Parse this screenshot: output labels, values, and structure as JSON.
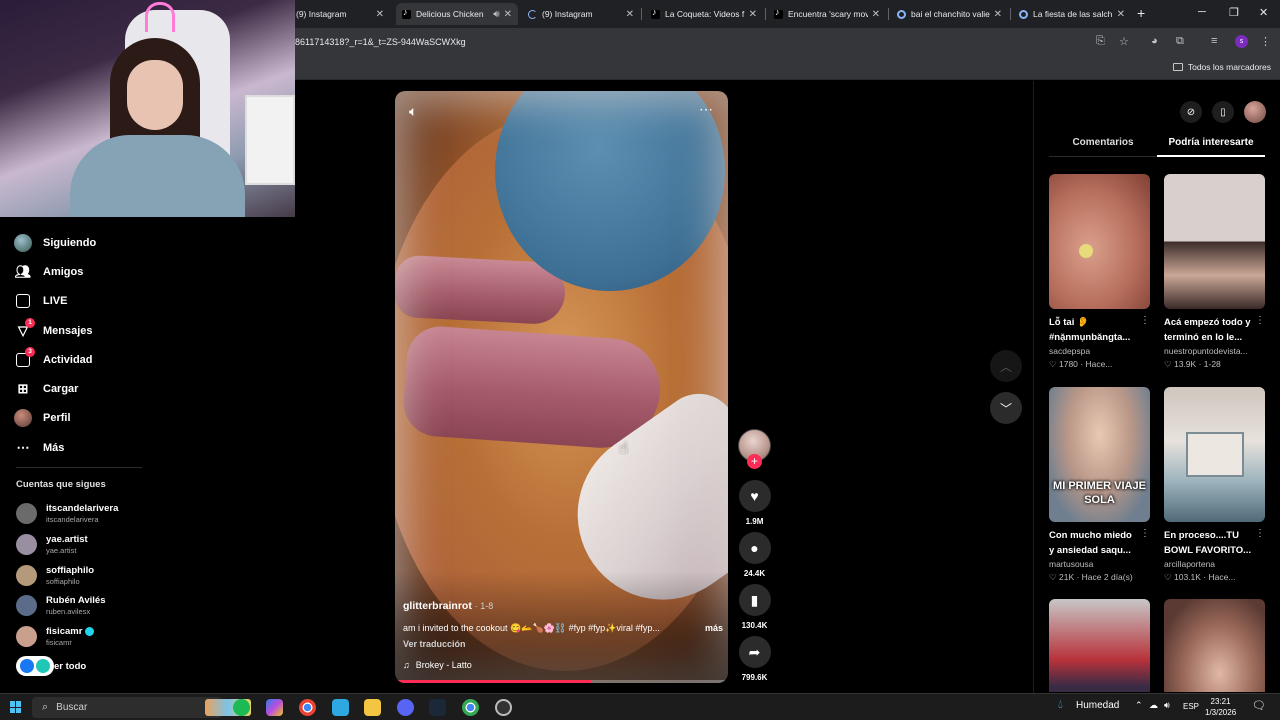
{
  "browser": {
    "tabs": [
      {
        "title": "(9) Instagram",
        "icon": "instagram-icon",
        "active": false
      },
      {
        "title": "Delicious Chicken",
        "icon": "tiktok-icon",
        "active": true
      },
      {
        "title": "(9) Instagram",
        "icon": "loading-icon",
        "active": false
      },
      {
        "title": "La Coqueta: Videos f",
        "icon": "tiktok-icon",
        "active": false
      },
      {
        "title": "Encuentra 'scary mov",
        "icon": "tiktok-icon",
        "active": false
      },
      {
        "title": "bai el chanchito valie",
        "icon": "google-icon",
        "active": false
      },
      {
        "title": "La fiesta de las salch",
        "icon": "google-icon",
        "active": false
      }
    ],
    "url": "8611714318?_r=1&_t=ZS-944WaSCWXkg",
    "profile_initial": "s",
    "bookmarks_all": "Todos los marcadores"
  },
  "sidebar": {
    "items": [
      {
        "label": "Siguiendo",
        "icon": "following-avatar-icon"
      },
      {
        "label": "Amigos",
        "icon": "friends-icon"
      },
      {
        "label": "LIVE",
        "icon": "live-icon"
      },
      {
        "label": "Mensajes",
        "icon": "messages-icon",
        "badge": "1"
      },
      {
        "label": "Actividad",
        "icon": "activity-icon",
        "badge": "3"
      },
      {
        "label": "Cargar",
        "icon": "upload-icon"
      },
      {
        "label": "Perfil",
        "icon": "profile-avatar-icon"
      },
      {
        "label": "Más",
        "icon": "more-icon"
      }
    ],
    "following_title": "Cuentas que sigues",
    "accounts": [
      {
        "name": "itscandelarivera",
        "handle": "itscandelarivera",
        "verified": false,
        "color": "#6b6b6b"
      },
      {
        "name": "yae.artist",
        "handle": "yae.artist",
        "verified": false,
        "color": "#9a8fa1"
      },
      {
        "name": "soffiaphilo",
        "handle": "soffiaphilo",
        "verified": false,
        "color": "#b49a7a"
      },
      {
        "name": "Rubén Avilés",
        "handle": "ruben.avilesx",
        "verified": false,
        "color": "#5a6c8a"
      },
      {
        "name": "fisicamr",
        "handle": "fisicamr",
        "verified": true,
        "color": "#c9a08e"
      }
    ],
    "see_all": "er todo"
  },
  "video": {
    "author": "glitterbrainrot",
    "date": "· 1-8",
    "caption": "am i invited to the cookout 😋🫴🍗🌸⛓️ #fyp #fyp✨viral #fyp...",
    "more": "más",
    "translate": "Ver traducción",
    "music": "Brokey - Latto",
    "progress": 0.59
  },
  "actions": {
    "likes": "1.9M",
    "comments": "24.4K",
    "saves": "130.4K",
    "shares": "799.6K"
  },
  "right_panel": {
    "tabs": [
      {
        "label": "Comentarios",
        "active": false
      },
      {
        "label": "Podría interesarte",
        "active": true
      }
    ],
    "cards": [
      {
        "title": "Lỗ tai 👂 #nặnmụnbăngta...",
        "user": "sacdepspa",
        "likes": "1780",
        "time": "Hace...",
        "thumb_caption": ""
      },
      {
        "title": "Acá empezó todo y terminó en lo le...",
        "user": "nuestropuntodevista...",
        "likes": "13.9K",
        "time": "1-28",
        "thumb_caption": ""
      },
      {
        "title": "Con mucho miedo y ansiedad saqu...",
        "user": "martusousa",
        "likes": "21K",
        "time": "Hace 2 día(s)",
        "thumb_caption": "MI PRIMER VIAJE SOLA"
      },
      {
        "title": "En proceso....TU BOWL FAVORITO...",
        "user": "arcillaportena",
        "likes": "103.1K",
        "time": "Hace...",
        "thumb_caption": ""
      },
      {
        "title": "",
        "user": "",
        "likes": "",
        "time": "",
        "thumb_caption": ""
      },
      {
        "title": "",
        "user": "",
        "likes": "",
        "time": "",
        "thumb_caption": ""
      }
    ]
  },
  "taskbar": {
    "search": "Buscar",
    "weather": "Humedad",
    "lang": "ESP",
    "time": "23:21",
    "date": "1/3/2026"
  },
  "colors": {
    "accent": "#fe2c55",
    "bg": "#000000"
  }
}
